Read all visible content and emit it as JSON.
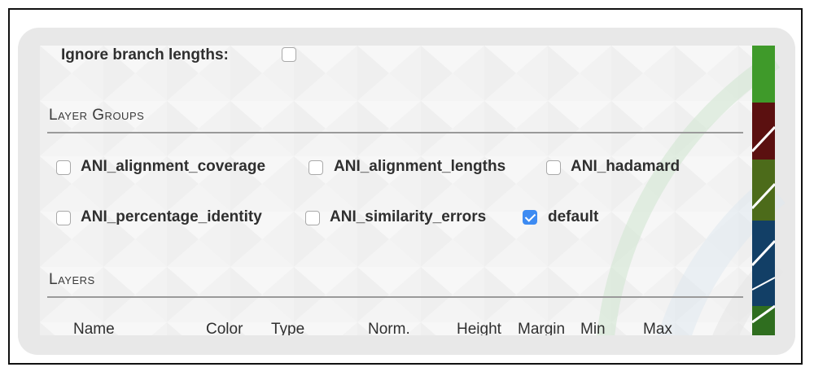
{
  "options": {
    "ignore_branch_lengths_label": "Ignore branch lengths:",
    "ignore_branch_lengths_checked": false
  },
  "layer_groups": {
    "title": "Layer Groups",
    "items": [
      {
        "label": "ANI_alignment_coverage",
        "checked": false
      },
      {
        "label": "ANI_alignment_lengths",
        "checked": false
      },
      {
        "label": "ANI_hadamard",
        "checked": false
      },
      {
        "label": "ANI_percentage_identity",
        "checked": false
      },
      {
        "label": "ANI_similarity_errors",
        "checked": false
      },
      {
        "label": "default",
        "checked": true
      }
    ]
  },
  "layers": {
    "title": "Layers",
    "columns": [
      "Name",
      "Color",
      "Type",
      "Norm.",
      "Height",
      "Margin",
      "Min",
      "Max"
    ]
  },
  "colors": {
    "checkbox_checked": "#3d8bf2",
    "strip": [
      "#3f9a2a",
      "#5b1010",
      "#4c6b1a",
      "#123f66",
      "#2f6e1f"
    ]
  }
}
